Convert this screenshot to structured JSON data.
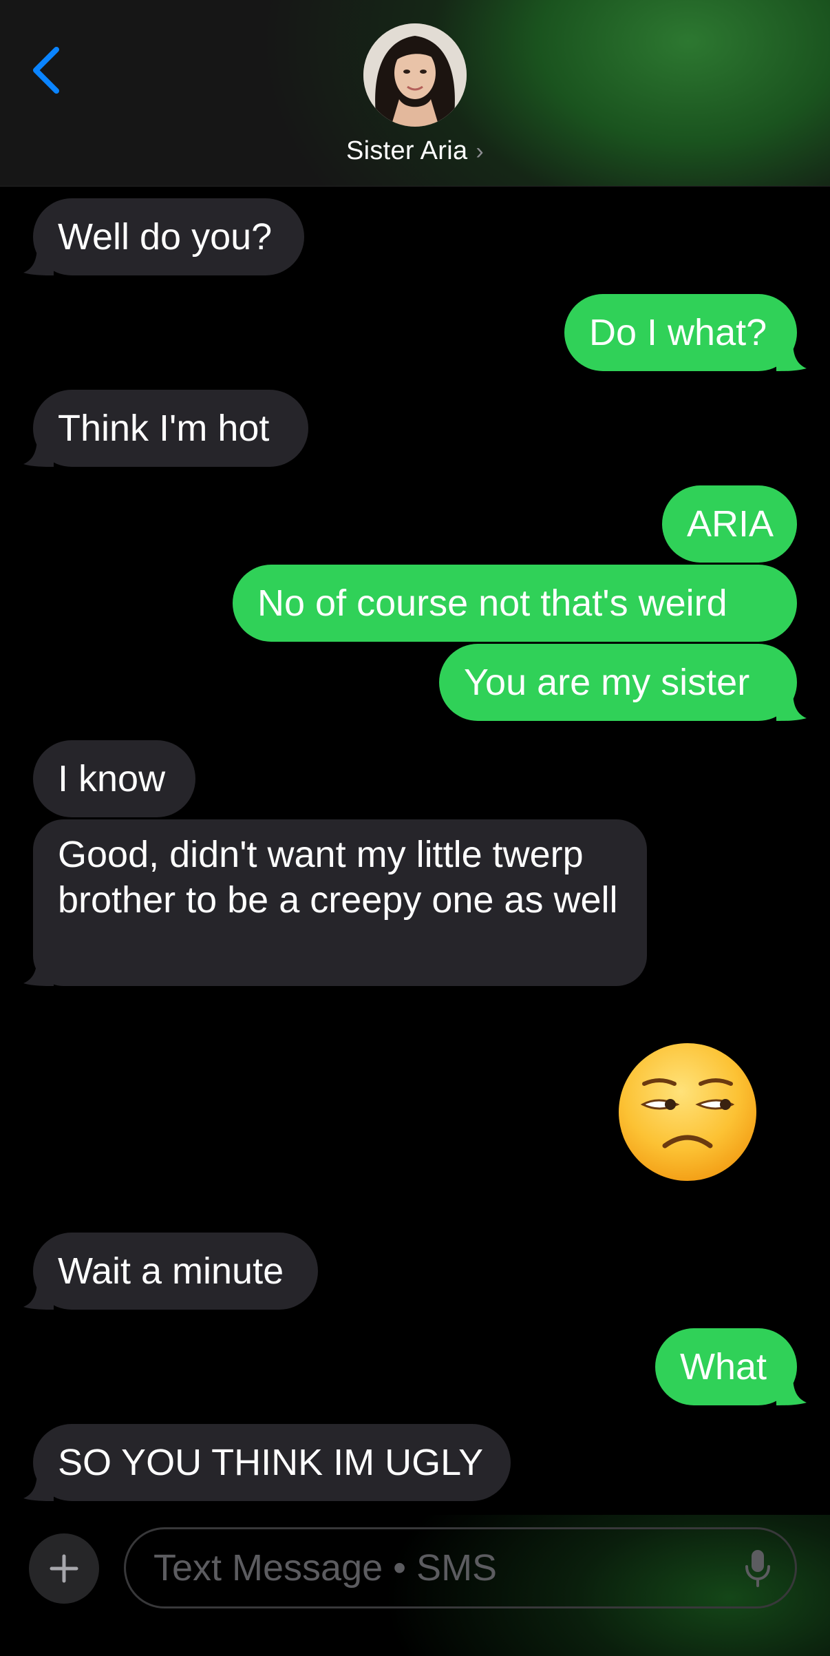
{
  "header": {
    "contact_name": "Sister Aria",
    "chevron": "›",
    "back_icon": "chevron-left-icon",
    "accent_color": "#0a84ff"
  },
  "messages": [
    {
      "direction": "incoming",
      "text": "Well do you?"
    },
    {
      "direction": "outgoing",
      "text": "Do I what?"
    },
    {
      "direction": "incoming",
      "text": "Think I'm hot"
    },
    {
      "direction": "outgoing",
      "text": "ARIA"
    },
    {
      "direction": "outgoing",
      "text": "No of course not that's weird"
    },
    {
      "direction": "outgoing",
      "text": "You are my sister"
    },
    {
      "direction": "incoming",
      "text": "I know"
    },
    {
      "direction": "incoming",
      "text": "Good, didn't want my little twerp brother to be a creepy one as well"
    },
    {
      "direction": "outgoing",
      "type": "emoji",
      "emoji": "unamused-face"
    },
    {
      "direction": "incoming",
      "text": "Wait a minute"
    },
    {
      "direction": "outgoing",
      "text": "What"
    },
    {
      "direction": "incoming",
      "text": "SO YOU THINK IM UGLY"
    }
  ],
  "composer": {
    "placeholder": "Text Message • SMS",
    "add_icon": "plus-icon",
    "mic_icon": "microphone-icon"
  },
  "colors": {
    "incoming_bubble": "#26252a",
    "outgoing_bubble": "#30d158",
    "background": "#000000"
  }
}
